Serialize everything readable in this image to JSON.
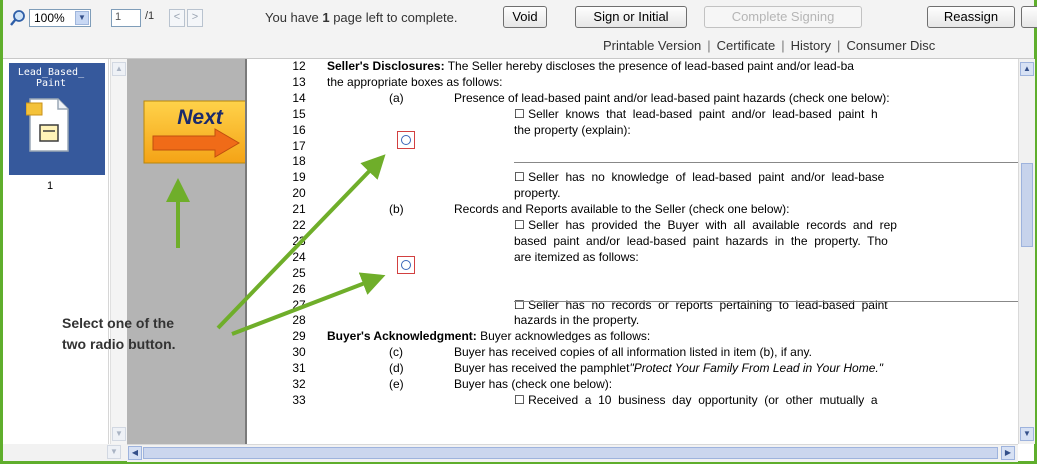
{
  "toolbar": {
    "zoom_value": "100%",
    "page_input": "1",
    "page_total": "/1",
    "prev_label": "<",
    "next_label": ">",
    "status_prefix": "You have ",
    "status_count": "1",
    "status_suffix": " page left to complete.",
    "buttons": {
      "void": "Void",
      "sign": "Sign or Initial",
      "complete": "Complete Signing",
      "reassign": "Reassign"
    },
    "links": [
      "Printable Version",
      "Certificate",
      "History",
      "Consumer Disc"
    ]
  },
  "sidebar": {
    "doc_title": "Lead_Based_ Paint",
    "page_number": "1"
  },
  "next_button": {
    "label": "Next"
  },
  "callout": {
    "line1": "Select one of the",
    "line2": "two radio button."
  },
  "document": {
    "lines": [
      {
        "n": "12",
        "parts": [
          {
            "t": "Seller's Disclosures:",
            "b": true
          },
          {
            "t": " The Seller hereby discloses the presence of lead-based paint and/or lead-ba"
          }
        ]
      },
      {
        "n": "13",
        "parts": [
          {
            "t": "the appropriate boxes as follows:"
          }
        ]
      },
      {
        "n": "14",
        "tag": "(a)",
        "text": "Presence of lead-based paint and/or lead-based paint hazards (check one below):"
      },
      {
        "n": "15",
        "text2": "☐ Seller  knows  that  lead-based  paint  and/or  lead-based  paint  h"
      },
      {
        "n": "16",
        "text2": "the property (explain):"
      },
      {
        "n": "17"
      },
      {
        "n": "18"
      },
      {
        "n": "19",
        "text2": "☐ Seller  has  no  knowledge  of  lead-based  paint  and/or  lead-base"
      },
      {
        "n": "20",
        "text2": "property."
      },
      {
        "n": "21",
        "tag": "(b)",
        "text": "Records and Reports available to the Seller (check one below):"
      },
      {
        "n": "22",
        "text2": "☐ Seller  has  provided  the  Buyer  with  all  available  records  and  rep"
      },
      {
        "n": "23",
        "text2": "based  paint  and/or  lead-based  paint  hazards  in  the  property.  Tho"
      },
      {
        "n": "24",
        "text2": "are itemized as follows:"
      },
      {
        "n": "25"
      },
      {
        "n": "26"
      },
      {
        "n": "27",
        "text2": "☐ Seller  has  no  records  or  reports  pertaining  to  lead-based  paint"
      },
      {
        "n": "28",
        "text2": "hazards in the property."
      },
      {
        "n": "29",
        "parts": [
          {
            "t": "Buyer's Acknowledgment:",
            "b": true
          },
          {
            "t": "  Buyer acknowledges as follows:"
          }
        ]
      },
      {
        "n": "30",
        "tag": "(c)",
        "text": "Buyer has received copies of all information listed in item (b), if any."
      },
      {
        "n": "31",
        "tag": "(d)",
        "text": "Buyer has received the pamphlet",
        "italic": "\"Protect Your Family From Lead in Your Home.\""
      },
      {
        "n": "32",
        "tag": "(e)",
        "text": "Buyer has (check one below):"
      },
      {
        "n": "33",
        "text2": "☐ Received  a  10  business  day  opportunity  (or  other  mutually  a"
      }
    ]
  }
}
